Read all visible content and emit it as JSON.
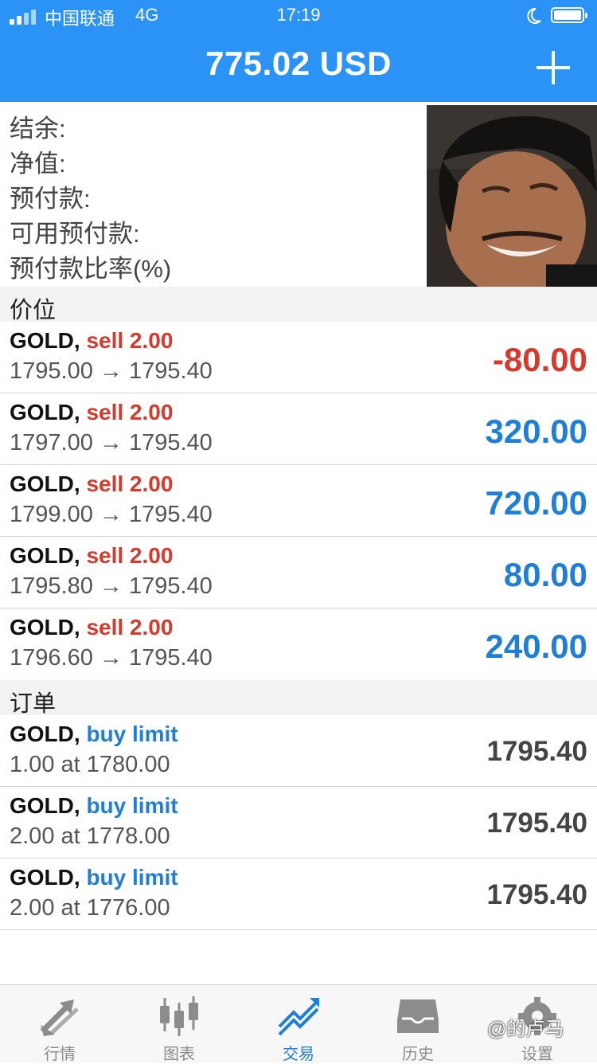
{
  "status_bar": {
    "carrier": "中国联通",
    "network": "4G",
    "time": "17:19"
  },
  "header": {
    "title": "775.02 USD",
    "add_icon": "plus-icon"
  },
  "account": {
    "labels": [
      "结余:",
      "净值:",
      "预付款:",
      "可用预付款:",
      "预付款比率(%)"
    ]
  },
  "positions": {
    "title": "价位",
    "items": [
      {
        "symbol": "GOLD,",
        "action": "sell 2.00",
        "prices": "1795.00 → 1795.40",
        "profit": "-80.00"
      },
      {
        "symbol": "GOLD,",
        "action": "sell 2.00",
        "prices": "1797.00 → 1795.40",
        "profit": "320.00"
      },
      {
        "symbol": "GOLD,",
        "action": "sell 2.00",
        "prices": "1799.00 → 1795.40",
        "profit": "720.00"
      },
      {
        "symbol": "GOLD,",
        "action": "sell 2.00",
        "prices": "1795.80 → 1795.40",
        "profit": "80.00"
      },
      {
        "symbol": "GOLD,",
        "action": "sell 2.00",
        "prices": "1796.60 → 1795.40",
        "profit": "240.00"
      }
    ]
  },
  "orders": {
    "title": "订单",
    "items": [
      {
        "symbol": "GOLD,",
        "action": "buy limit",
        "detail": "1.00 at 1780.00",
        "price": "1795.40"
      },
      {
        "symbol": "GOLD,",
        "action": "buy limit",
        "detail": "2.00 at 1778.00",
        "price": "1795.40"
      },
      {
        "symbol": "GOLD,",
        "action": "buy limit",
        "detail": "2.00 at 1776.00",
        "price": "1795.40"
      }
    ]
  },
  "tabbar": {
    "tabs": [
      {
        "label": "行情",
        "icon": "quotes-arrows-icon"
      },
      {
        "label": "图表",
        "icon": "candlestick-chart-icon"
      },
      {
        "label": "交易",
        "icon": "trade-trend-icon",
        "active": true
      },
      {
        "label": "历史",
        "icon": "history-inbox-icon"
      },
      {
        "label": "设置",
        "icon": "settings-gear-icon"
      }
    ]
  },
  "watermark": "@的卢马",
  "colors": {
    "header": "#2a93f5",
    "sell": "#d63a2c",
    "buy": "#1f7fd6",
    "profit": "#1f7fd6",
    "loss": "#d63a2c"
  }
}
